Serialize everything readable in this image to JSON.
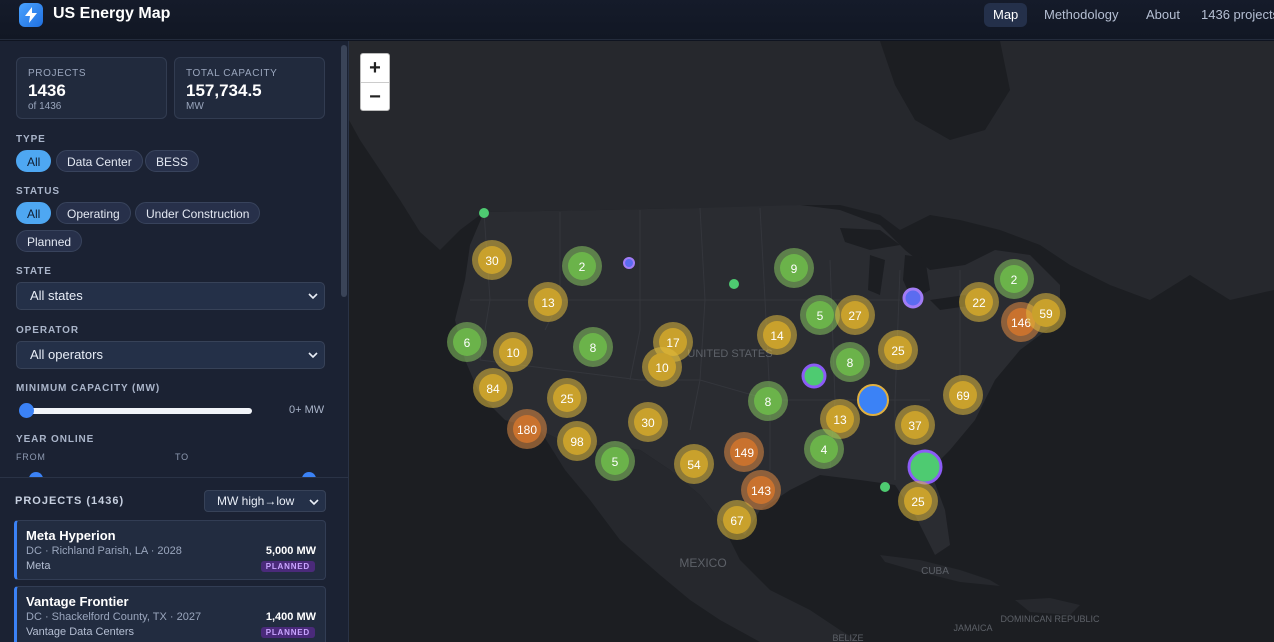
{
  "app": {
    "title": "US Energy Map",
    "nav": [
      "Map",
      "Methodology",
      "About"
    ],
    "projects_count": "1436 projects"
  },
  "stats": {
    "projects_label": "PROJECTS",
    "projects_value": "1436",
    "projects_sub": "of 1436",
    "capacity_label": "TOTAL CAPACITY",
    "capacity_value": "157,734.5",
    "capacity_sub": "MW"
  },
  "filters": {
    "type_label": "TYPE",
    "type_options": [
      "All",
      "Data Center",
      "BESS"
    ],
    "type_selected": "All",
    "status_label": "STATUS",
    "status_options": [
      "All",
      "Operating",
      "Under Construction",
      "Planned"
    ],
    "status_selected": "All",
    "state_label": "STATE",
    "state_value": "All states",
    "operator_label": "OPERATOR",
    "operator_value": "All operators",
    "min_capacity_label": "MINIMUM CAPACITY (MW)",
    "min_capacity_readout": "0+ MW",
    "min_capacity_value": 0,
    "year_label": "YEAR ONLINE",
    "from_label": "FROM",
    "to_label": "TO"
  },
  "projects": {
    "header": "PROJECTS (1436)",
    "sort_value": "MW high→low",
    "items": [
      {
        "name": "Meta Hyperion",
        "meta": "DC · Richland Parish, LA · 2028",
        "mw": "5,000 MW",
        "operator": "Meta",
        "status": "PLANNED"
      },
      {
        "name": "Vantage Frontier",
        "meta": "DC · Shackelford County, TX · 2027",
        "mw": "1,400 MW",
        "operator": "Vantage Data Centers",
        "status": "PLANNED"
      }
    ]
  },
  "map": {
    "labels": [
      "UNITED STATES",
      "MEXICO",
      "CUBA",
      "DOMINICAN REPUBLIC",
      "JAMAICA",
      "BELIZE"
    ],
    "zoom_in": "+",
    "zoom_out": "−",
    "colors": {
      "green": "#6bb34a",
      "yellow": "#d9b234",
      "orange": "#d98a34",
      "blue": "#3b82f6",
      "purple": "#8b5cf6"
    },
    "clusters": [
      "30",
      "2",
      "13",
      "6",
      "10",
      "8",
      "17",
      "10",
      "84",
      "25",
      "180",
      "98",
      "30",
      "5",
      "54",
      "149",
      "143",
      "67",
      "9",
      "14",
      "5",
      "27",
      "8",
      "8",
      "13",
      "4",
      "37",
      "25",
      "69",
      "22",
      "146",
      "59",
      "2",
      "25"
    ]
  }
}
